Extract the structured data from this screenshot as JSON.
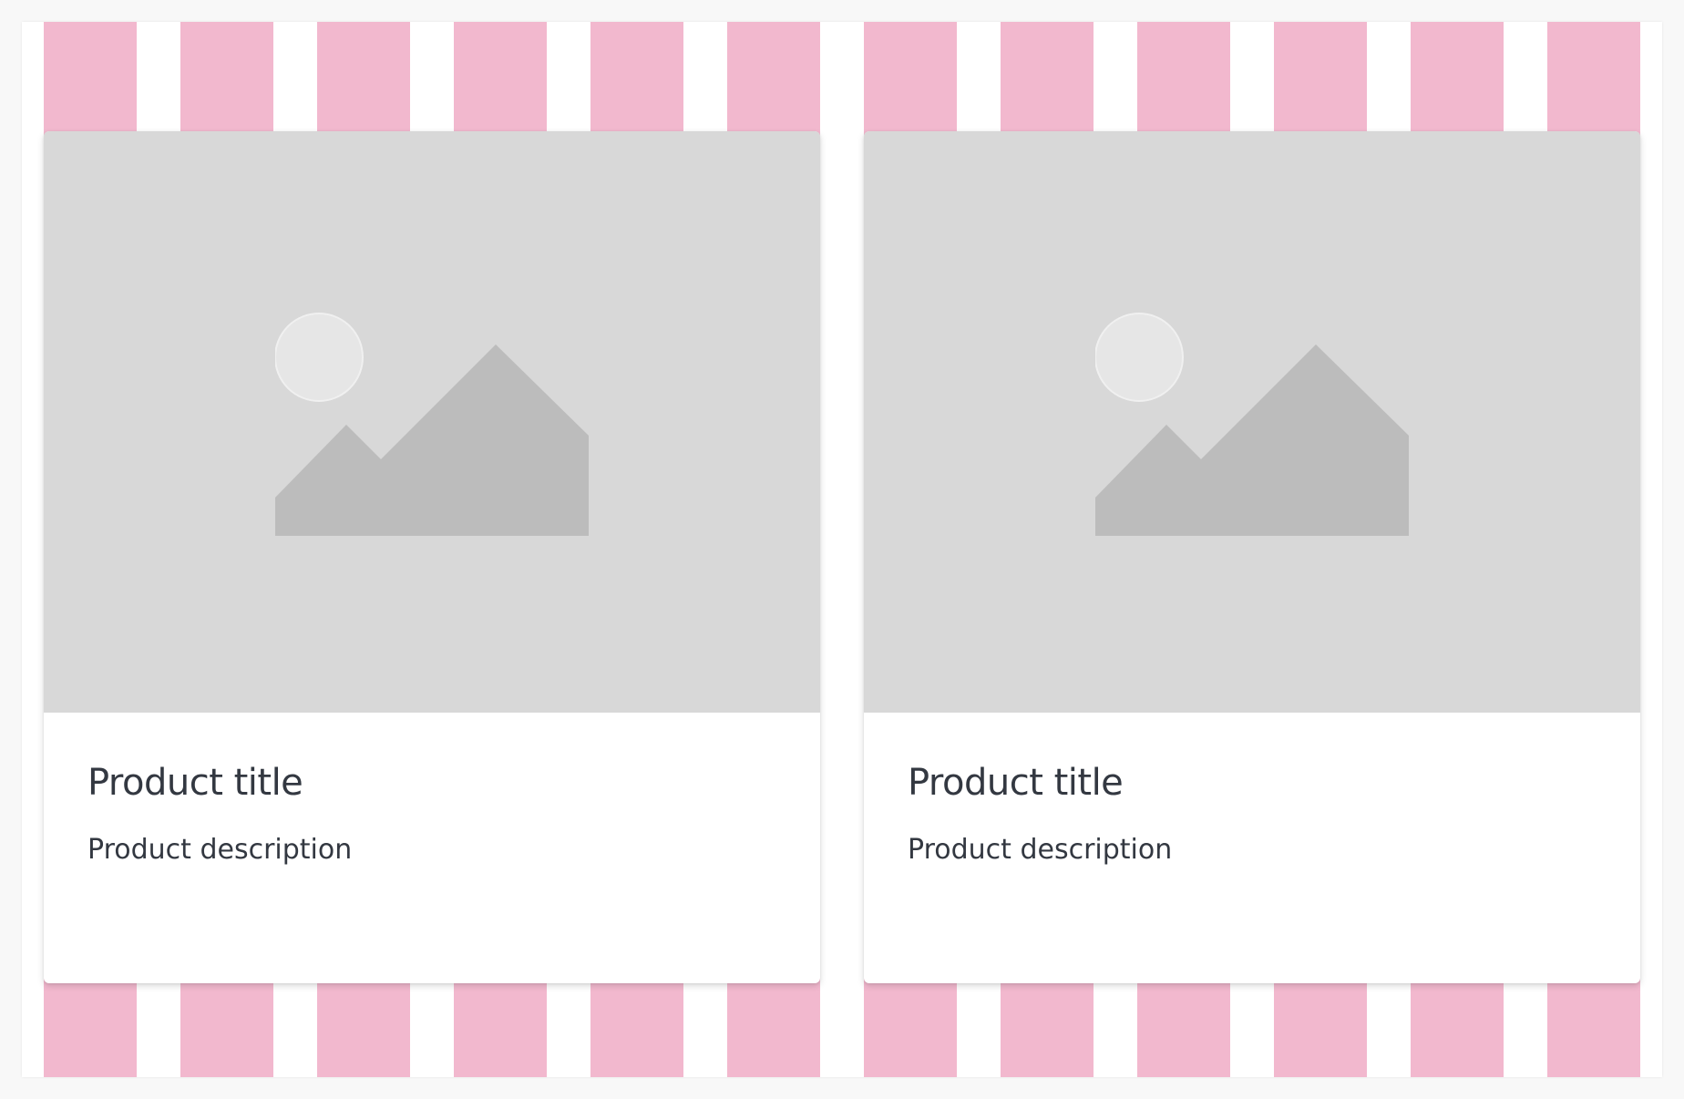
{
  "colors": {
    "page_background": "#f8f8f8",
    "stripe_pink": "#f2b8ce",
    "image_placeholder": "#d8d8d8",
    "mountain": "#bcbcbc",
    "sun": "#e6e6e6",
    "text": "#333841"
  },
  "cards": [
    {
      "image_icon": "image-placeholder-icon",
      "title": "Product title",
      "description": "Product description"
    },
    {
      "image_icon": "image-placeholder-icon",
      "title": "Product title",
      "description": "Product description"
    }
  ]
}
